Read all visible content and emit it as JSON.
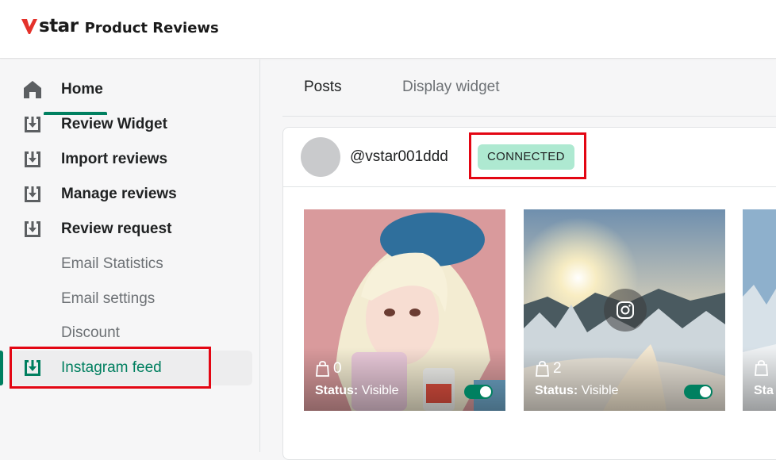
{
  "app": {
    "logo_mark": "star",
    "title": "Product Reviews"
  },
  "sidebar": {
    "items": [
      {
        "label": "Home",
        "icon": "home-icon"
      },
      {
        "label": "Review Widget",
        "icon": "download-box-icon"
      },
      {
        "label": "Import reviews",
        "icon": "download-box-icon"
      },
      {
        "label": "Manage reviews",
        "icon": "download-box-icon"
      },
      {
        "label": "Review request",
        "icon": "download-box-icon"
      },
      {
        "label": "Email Statistics"
      },
      {
        "label": "Email settings"
      },
      {
        "label": "Discount"
      },
      {
        "label": "Instagram feed",
        "icon": "download-box-icon",
        "active": true
      }
    ]
  },
  "tabs": [
    {
      "label": "Posts",
      "selected": true
    },
    {
      "label": "Display widget",
      "selected": false
    }
  ],
  "account": {
    "username": "@vstar001ddd",
    "status": "CONNECTED"
  },
  "posts": [
    {
      "count": "0",
      "status_label": "Status:",
      "status_value": "Visible",
      "visible": true,
      "theme": "portrait"
    },
    {
      "count": "2",
      "status_label": "Status:",
      "status_value": "Visible",
      "visible": true,
      "theme": "winter-sunset"
    },
    {
      "count": "",
      "status_label": "Sta",
      "status_value": "",
      "visible": true,
      "theme": "winter-partial"
    }
  ],
  "colors": {
    "accent": "#008060",
    "badge_bg": "#aee9d1",
    "highlight": "#e30613",
    "logo_red": "#e4322b"
  }
}
